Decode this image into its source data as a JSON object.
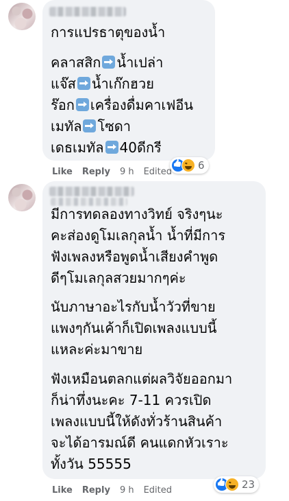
{
  "comments": [
    {
      "lines": [
        "การแปรธาตุของน้ำ",
        "",
        "คลาสสิก|น้ำเปล่า",
        "แจ๊ส|น้ำเก๊กฮวย",
        "ร๊อก|เครื่องดื่มคาเฟอีน",
        "เมทัล|โซดา",
        "เดธเมทัล|40ดีกรี"
      ],
      "like_label": "Like",
      "reply_label": "Reply",
      "time": "9 h",
      "edited_label": "Edited",
      "reaction_count": "6"
    },
    {
      "lines": [
        "มีการทดลองทางวิทย์ จริงๆนะ",
        "คะส่องดูโมเลกุลน้ำ น้ำที่มีการ",
        "ฟังเพลงหรือพูดน้ำเสียงคำพูด",
        "ดีๆโมเลกุลสวยมากๆค่ะ",
        "นับภาษาอะไรกับน้ำวัวที่ขาย",
        "แพงๆกันเค้าก็เปิดเพลงแบบนี้",
        "แหละค่ะมาขาย",
        "ฟังเหมือนตลกแต่ผลวิจัยออกมา",
        "ก็น่าทึ่งนะคะ 7-11 ควรเปิด",
        "เพลงแบบนี้ให้ดังทั่วร้านสินค้า",
        "จะได้อารมณ์ดี คนแดกหัวเราะ",
        "ทั้งวัน 55555"
      ],
      "like_label": "Like",
      "reply_label": "Reply",
      "time": "9 h",
      "edited_label": "Edited",
      "reaction_count": "23"
    }
  ],
  "colors": {
    "bubble": "#f0f2f5",
    "meta_text": "#65676b",
    "like_blue": "#1877f2",
    "haha_yellow": "#f7b125",
    "arrow_icon": "#6fa8dc"
  }
}
